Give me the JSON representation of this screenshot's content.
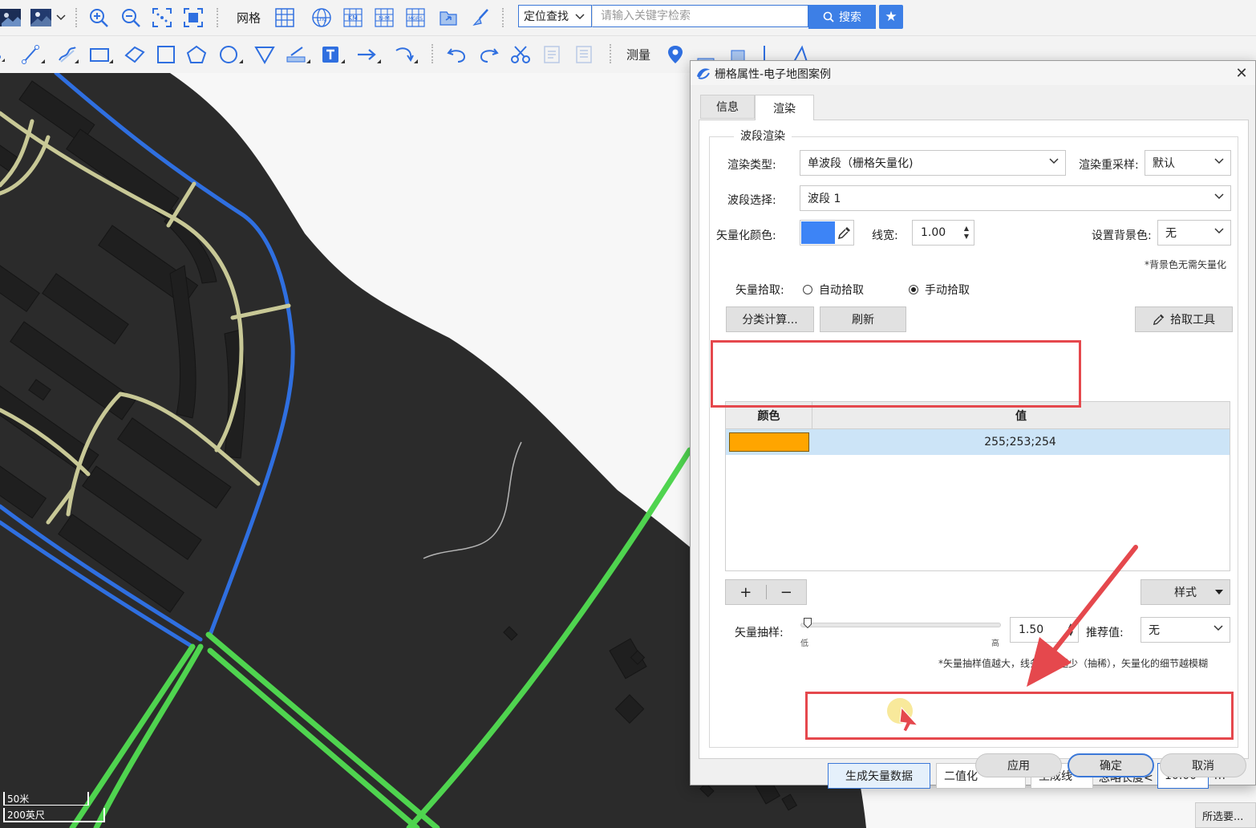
{
  "toolbar1": {
    "grid_label": "网格",
    "grid_buttons": [
      "Lng",
      "KM",
      "N-M",
      "MGRS"
    ],
    "search": {
      "mode_label": "定位查找",
      "placeholder": "请输入关键字检索",
      "button_label": "搜索"
    }
  },
  "toolbar2": {
    "measure_label": "测量"
  },
  "map": {
    "scale_metric": "50米",
    "scale_imperial": "200英尺",
    "status_select": "所选要..."
  },
  "dialog": {
    "title": "栅格属性-电子地图案例",
    "tabs": [
      {
        "label": "信息",
        "active": false
      },
      {
        "label": "渲染",
        "active": true
      }
    ],
    "group_title": "波段渲染",
    "render_type_label": "渲染类型:",
    "render_type_value": "单波段（栅格矢量化)",
    "resample_label": "渲染重采样:",
    "resample_value": "默认",
    "band_label": "波段选择:",
    "band_value": "波段 1",
    "vector_color_label": "矢量化颜色:",
    "vector_color": "#3d84f6",
    "line_width_label": "线宽:",
    "line_width_value": "1.00",
    "bg_color_label": "设置背景色:",
    "bg_color_value": "无",
    "bg_note": "*背景色无需矢量化",
    "pick_label": "矢量拾取:",
    "pick_auto": "自动拾取",
    "pick_manual": "手动拾取",
    "pick_selected": "manual",
    "classify_button": "分类计算...",
    "refresh_button": "刷新",
    "pick_tool_button": "拾取工具",
    "table": {
      "columns": [
        "颜色",
        "值"
      ],
      "rows": [
        {
          "color": "#ffa500",
          "value": "255;253;254",
          "selected": true
        }
      ]
    },
    "add_button": "+",
    "remove_button": "−",
    "style_button": "样式",
    "sampling_label": "矢量抽样:",
    "sampling_low": "低",
    "sampling_high": "高",
    "sampling_value": "1.50",
    "recommended_label": "推荐值:",
    "recommended_value": "无",
    "sampling_note": "*矢量抽样值越大，线条的点越少（抽稀），矢量化的细节越模糊",
    "generate_button": "生成矢量数据",
    "binarize_value": "二值化",
    "generate_type_value": "生成线",
    "ignore_length_label": "忽略长度<",
    "ignore_length_value": "10.00",
    "ignore_length_unit": "m",
    "apply_button": "应用",
    "ok_button": "确定",
    "cancel_button": "取消"
  },
  "colors": {
    "accent": "#3d7fe6",
    "road_blue": "#2f6fe0",
    "road_green": "#4fd44f",
    "road_khaki": "#c8c896",
    "map_dark": "#2b2b2b",
    "highlight_red": "#e5484d",
    "selected_row": "#cce4f7"
  }
}
